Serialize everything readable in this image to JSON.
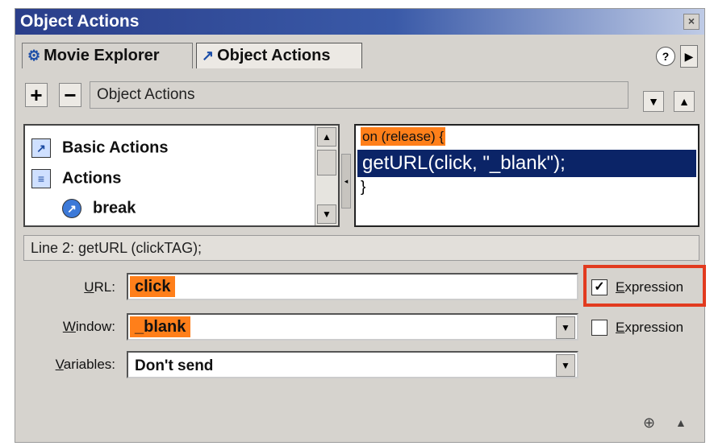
{
  "window": {
    "title": "Object Actions",
    "close_label": "×"
  },
  "tabs": [
    {
      "label": "Movie Explorer",
      "icon": "movie-explorer-icon",
      "active": false
    },
    {
      "label": "Object Actions",
      "icon": "object-actions-icon",
      "active": true
    }
  ],
  "toolbar": {
    "add_label": "+",
    "remove_label": "−",
    "title": "Object Actions",
    "help_label": "?"
  },
  "actions_list": {
    "items": [
      {
        "label": "Basic Actions",
        "icon": "book-icon"
      },
      {
        "label": "Actions",
        "icon": "book-icon"
      },
      {
        "label": "break",
        "icon": "action-icon"
      }
    ]
  },
  "script": {
    "line1": "on (release) {",
    "line2": "getURL(click, \"_blank\");",
    "line3": "}"
  },
  "status": {
    "text": "Line 2: getURL (clickTAG);"
  },
  "params": {
    "url": {
      "label_u": "U",
      "label_rest": "RL:",
      "value": "click",
      "expression_checked": true
    },
    "window": {
      "label_u": "W",
      "label_rest": "indow:",
      "value": "_blank",
      "expression_checked": false
    },
    "variables": {
      "label_u": "V",
      "label_rest": "ariables:",
      "value": "Don't send"
    },
    "expression_label_u": "E",
    "expression_label_rest": "xpression"
  },
  "colors": {
    "highlight": "#ff7f1a",
    "selection": "#0b2467",
    "callout": "#e23b1f"
  }
}
